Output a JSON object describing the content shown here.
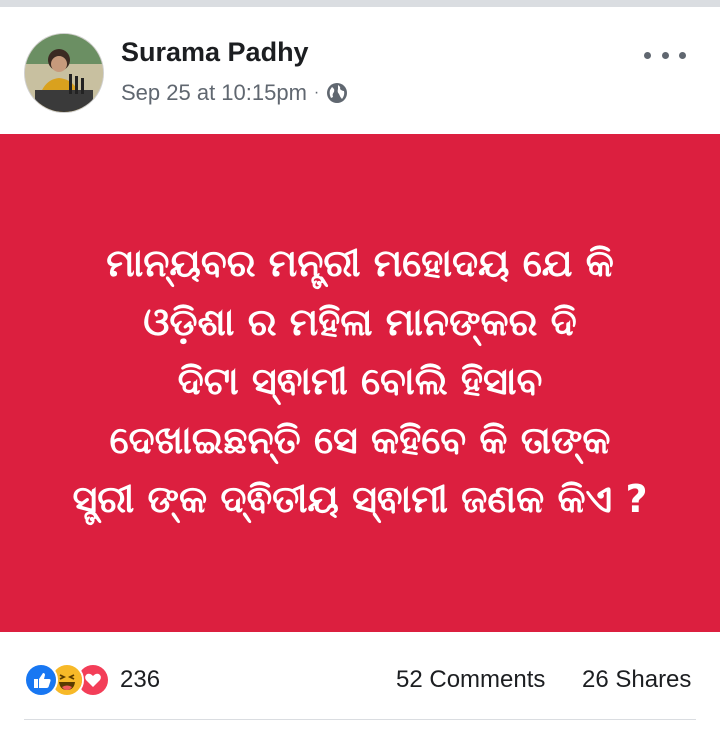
{
  "post": {
    "author": "Surama Padhy",
    "timestamp": "Sep 25 at 10:15pm",
    "separator": "·",
    "privacy_icon": "globe-icon",
    "more_icon": "ellipsis-icon",
    "card_background": "#dc1f3f",
    "text": "ମାନ୍ୟବର ମନ୍ତ୍ରୀ ମହୋଦୟ ଯେ କି\nଓଡ଼ିଶା ର ମହିଳା ମାନଙ୍କର ଦି\nଦିଟା ସ୍ଵାମୀ ବୋଲି ହିସାବ\nଦେଖାଇଛନ୍ତି ସେ କହିବେ କି ତାଙ୍କ\nସ୍ତ୍ରୀ ଙ୍କ ଦ୍ଵିତୀୟ ସ୍ଵାମୀ ଜଣକ କିଏ ?"
  },
  "footer": {
    "reactions": [
      "like-icon",
      "haha-icon",
      "love-icon"
    ],
    "reaction_count": "236",
    "comments": "52 Comments",
    "shares": "26 Shares"
  }
}
